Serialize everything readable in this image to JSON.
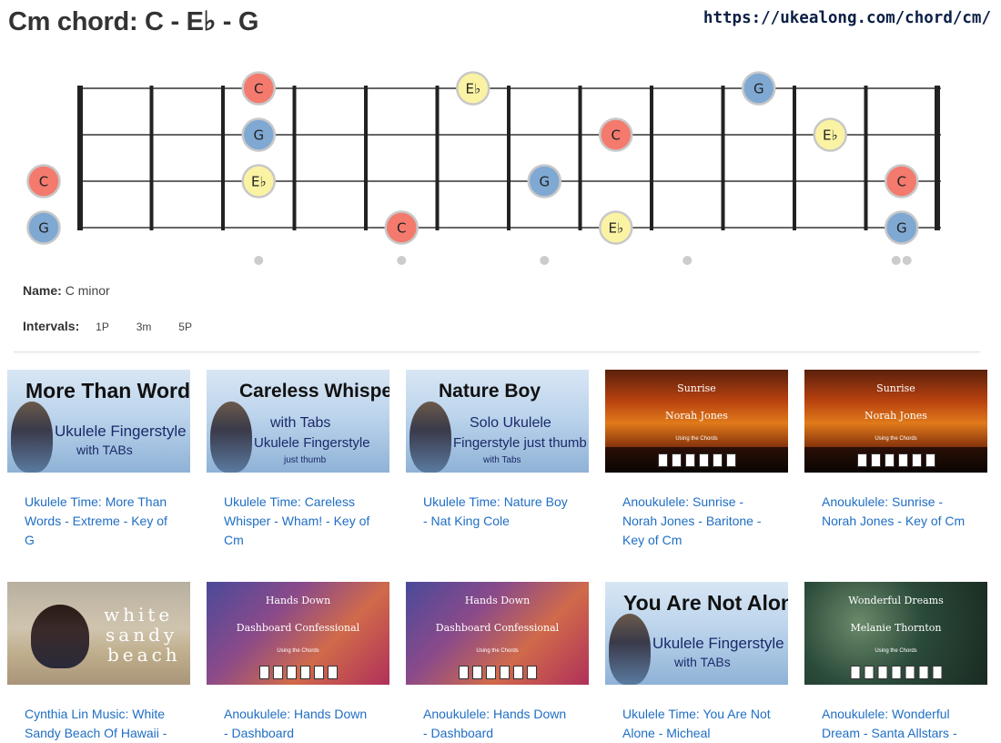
{
  "header": {
    "title": "Cm chord: C - E♭ - G",
    "url": "https://ukealong.com/chord/cm/"
  },
  "colors": {
    "C": "#f47a6e",
    "E♭": "#fbf3a4",
    "G": "#7fa9d3",
    "dot_border": "#c8c8c8",
    "fret_line": "#222222",
    "string_line": "#333333",
    "marker": "#cccccc",
    "link": "#1f6ec4"
  },
  "fretboard": {
    "frets": 12,
    "string_count": 4,
    "open_notes": [
      {
        "string": 3,
        "note": "C"
      },
      {
        "string": 4,
        "note": "G"
      }
    ],
    "notes": [
      {
        "string": 1,
        "fret": 3,
        "note": "C"
      },
      {
        "string": 1,
        "fret": 6,
        "note": "E♭"
      },
      {
        "string": 1,
        "fret": 10,
        "note": "G"
      },
      {
        "string": 2,
        "fret": 3,
        "note": "G"
      },
      {
        "string": 2,
        "fret": 8,
        "note": "C"
      },
      {
        "string": 2,
        "fret": 11,
        "note": "E♭"
      },
      {
        "string": 3,
        "fret": 3,
        "note": "E♭"
      },
      {
        "string": 3,
        "fret": 7,
        "note": "G"
      },
      {
        "string": 3,
        "fret": 12,
        "note": "C"
      },
      {
        "string": 4,
        "fret": 5,
        "note": "C"
      },
      {
        "string": 4,
        "fret": 8,
        "note": "E♭"
      },
      {
        "string": 4,
        "fret": 12,
        "note": "G"
      }
    ],
    "markers": [
      3,
      5,
      7,
      9,
      12
    ]
  },
  "info": {
    "name_label": "Name:",
    "name_value": "C minor",
    "intervals_label": "Intervals:",
    "intervals": [
      "1P",
      "3m",
      "5P"
    ]
  },
  "videos": [
    {
      "title": "Ukulele Time: More Than Words - Extreme - Key of G",
      "thumb_style": "blue",
      "thumb_lines": [
        "More Than Words",
        "Ukulele Fingerstyle",
        "with TABs"
      ]
    },
    {
      "title": "Ukulele Time: Careless Whisper - Wham! - Key of Cm",
      "thumb_style": "blue",
      "thumb_lines": [
        "Careless Whisper",
        "with Tabs",
        "Ukulele Fingerstyle",
        "just thumb"
      ]
    },
    {
      "title": "Ukulele Time: Nature Boy - Nat King Cole",
      "thumb_style": "blue",
      "thumb_lines": [
        "Nature Boy",
        "Solo Ukulele",
        "Fingerstyle just thumb",
        "with Tabs"
      ]
    },
    {
      "title": "Anoukulele: Sunrise - Norah Jones - Baritone - Key of Cm",
      "thumb_style": "sunset",
      "thumb_lines": [
        "Sunrise",
        "Norah Jones",
        "Using the Chords"
      ]
    },
    {
      "title": "Anoukulele: Sunrise - Norah Jones - Key of Cm",
      "thumb_style": "sunset",
      "thumb_lines": [
        "Sunrise",
        "Norah Jones",
        "Using the Chords"
      ]
    },
    {
      "title": "Cynthia Lin Music: White Sandy Beach Of Hawaii -",
      "thumb_style": "beach",
      "thumb_lines": [
        "white",
        "sandy",
        "beach"
      ]
    },
    {
      "title": "Anoukulele: Hands Down - Dashboard",
      "thumb_style": "purple",
      "thumb_lines": [
        "Hands Down",
        "Dashboard Confessional",
        "Using the Chords"
      ]
    },
    {
      "title": "Anoukulele: Hands Down - Dashboard",
      "thumb_style": "purple",
      "thumb_lines": [
        "Hands Down",
        "Dashboard Confessional",
        "Using the Chords"
      ]
    },
    {
      "title": "Ukulele Time: You Are Not Alone - Micheal",
      "thumb_style": "blue",
      "thumb_lines": [
        "You Are Not Alone",
        "Ukulele Fingerstyle",
        "with TABs"
      ]
    },
    {
      "title": "Anoukulele: Wonderful Dream - Santa Allstars -",
      "thumb_style": "xmas",
      "thumb_lines": [
        "Wonderful Dreams",
        "Melanie Thornton",
        "Using the Chords"
      ]
    }
  ]
}
